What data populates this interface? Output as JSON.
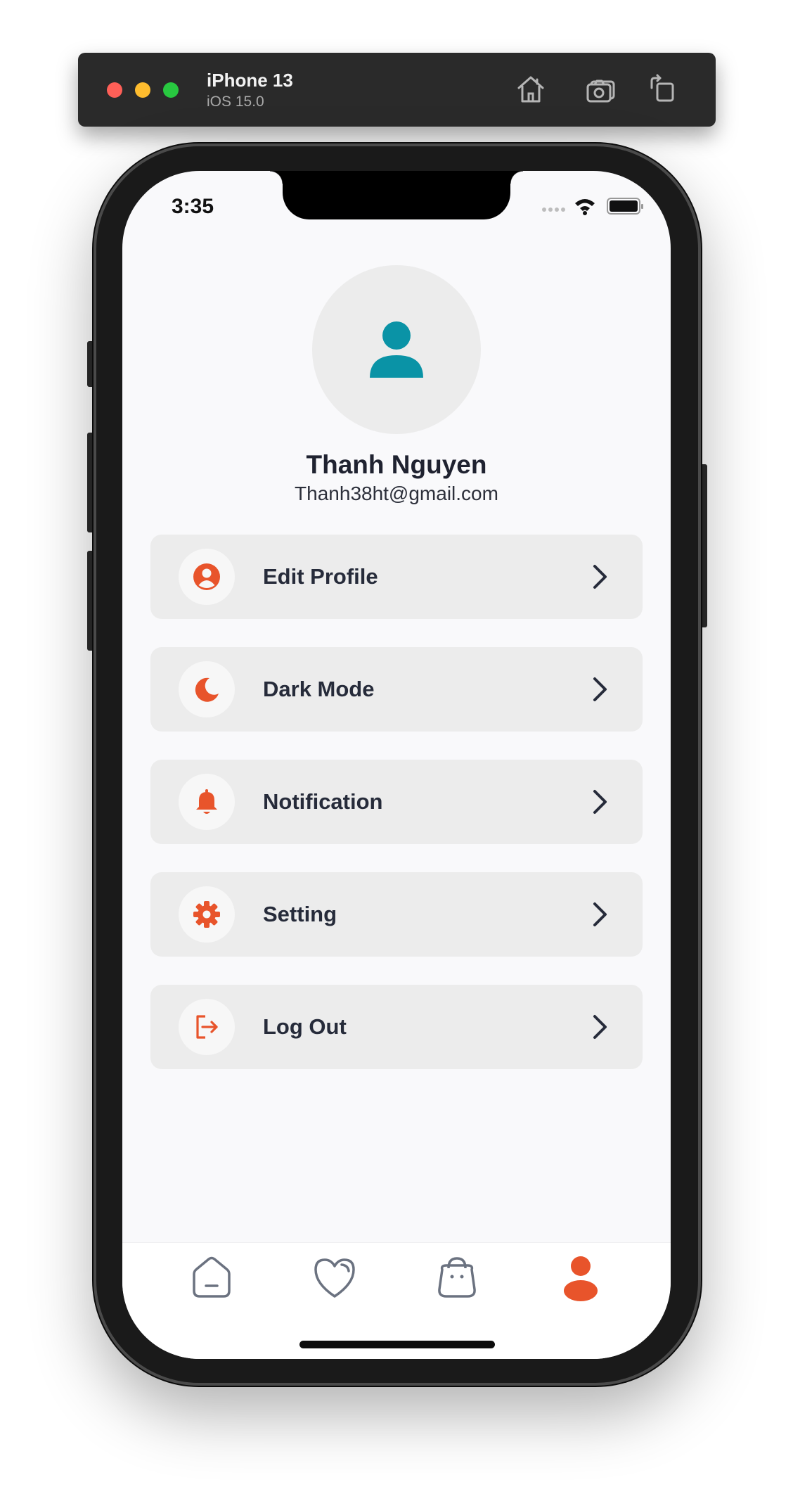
{
  "simulator": {
    "device_name": "iPhone 13",
    "os_version": "iOS 15.0",
    "buttons": [
      {
        "icon": "home-icon"
      },
      {
        "icon": "camera-icon"
      },
      {
        "icon": "rotate-icon"
      }
    ]
  },
  "status_bar": {
    "time": "3:35",
    "icons": [
      "signal-icon",
      "wifi-icon",
      "battery-icon"
    ]
  },
  "profile": {
    "name": "Thanh Nguyen",
    "email": "Thanh38ht@gmail.com",
    "avatar_icon": "user-icon"
  },
  "menu": [
    {
      "label": "Edit Profile",
      "icon": "user-circle-icon"
    },
    {
      "label": "Dark Mode",
      "icon": "moon-icon"
    },
    {
      "label": "Notification",
      "icon": "bell-icon"
    },
    {
      "label": "Setting",
      "icon": "gear-icon"
    },
    {
      "label": "Log Out",
      "icon": "logout-icon"
    }
  ],
  "tab_bar": {
    "items": [
      {
        "icon": "home-icon",
        "active": false
      },
      {
        "icon": "heart-icon",
        "active": false
      },
      {
        "icon": "bag-icon",
        "active": false
      },
      {
        "icon": "profile-icon",
        "active": true
      }
    ]
  },
  "colors": {
    "accent": "#e8542b",
    "avatar_icon": "#0a93a6",
    "text_primary": "#262b3a",
    "menu_bg": "#ececec",
    "screen_bg": "#f9f9fb",
    "tab_inactive": "#6b7280"
  }
}
